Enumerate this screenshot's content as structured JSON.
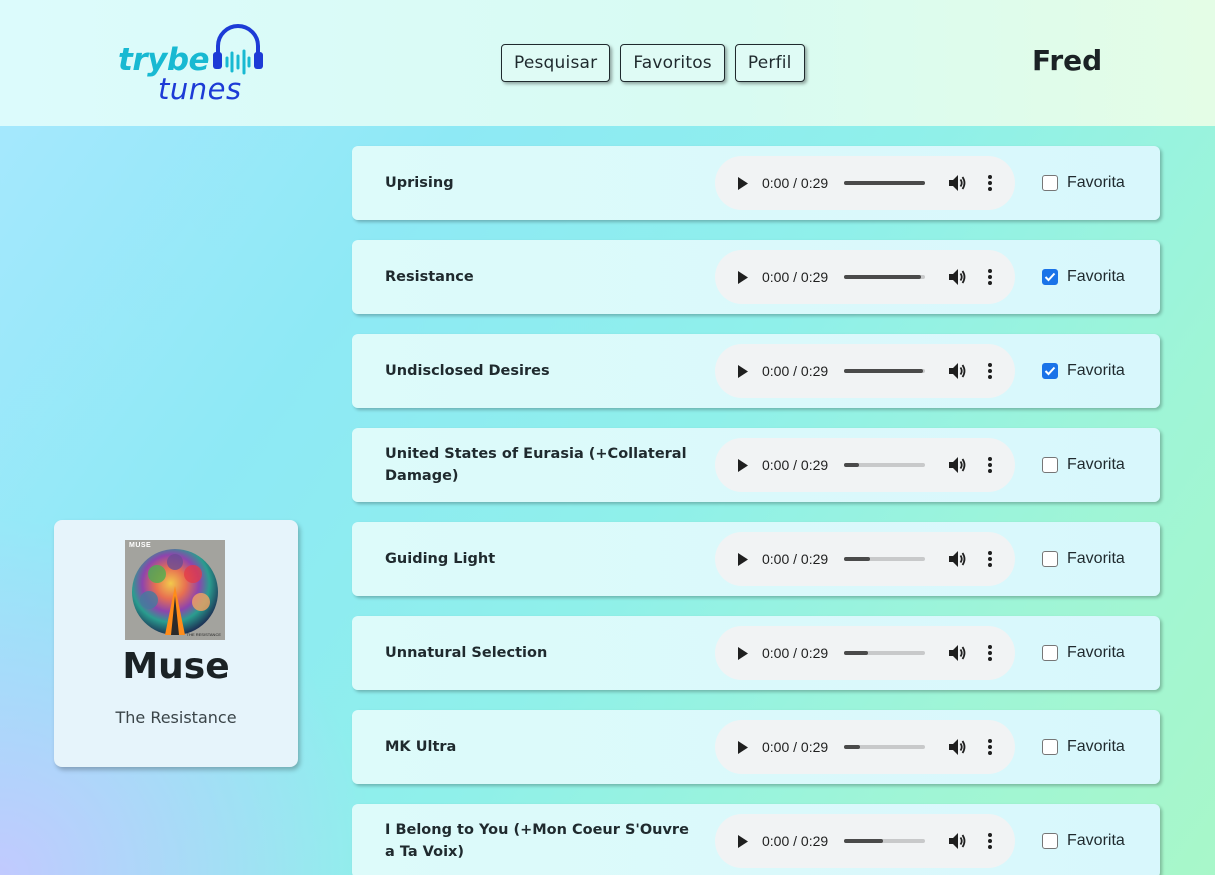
{
  "header": {
    "logo_word_1": "trybe",
    "logo_word_2": "tunes",
    "nav": [
      "Pesquisar",
      "Favoritos",
      "Perfil"
    ],
    "user_name": "Fred"
  },
  "album": {
    "cover_brand": "MUSE",
    "cover_subtitle": "THE RESISTANCE",
    "artist": "Muse",
    "name": "The Resistance"
  },
  "player_time": "0:00 / 0:29",
  "favorite_label": "Favorita",
  "tracks": [
    {
      "name": "Uprising",
      "favorite": false,
      "progress": 1.0
    },
    {
      "name": "Resistance",
      "favorite": true,
      "progress": 0.95
    },
    {
      "name": "Undisclosed Desires",
      "favorite": true,
      "progress": 0.97
    },
    {
      "name": "United States of Eurasia (+Collateral Damage)",
      "favorite": false,
      "progress": 0.18
    },
    {
      "name": "Guiding Light",
      "favorite": false,
      "progress": 0.32
    },
    {
      "name": "Unnatural Selection",
      "favorite": false,
      "progress": 0.3
    },
    {
      "name": "MK Ultra",
      "favorite": false,
      "progress": 0.2
    },
    {
      "name": "I Belong to You (+Mon Coeur S'Ouvre a Ta Voix)",
      "favorite": false,
      "progress": 0.48
    }
  ],
  "colors": {
    "logo_primary": "#18b9d2",
    "logo_secondary": "#1d3bd6",
    "checkbox_checked": "#1a73e8"
  }
}
